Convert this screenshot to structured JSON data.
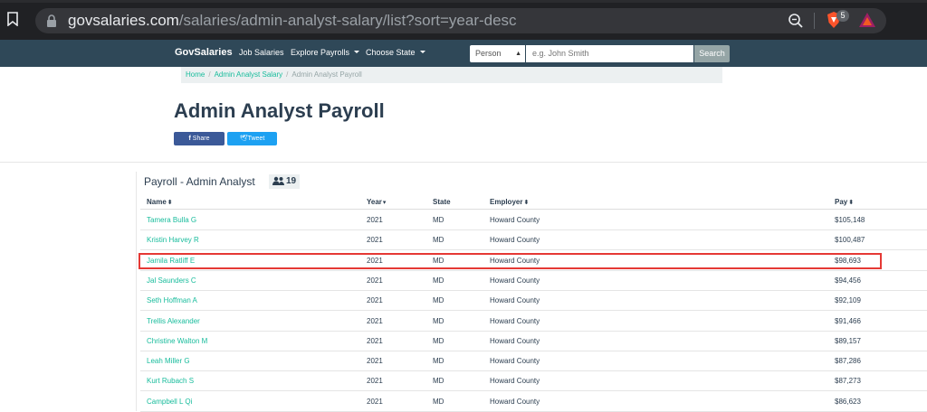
{
  "browser": {
    "url_host": "govsalaries.com",
    "url_path": "/salaries/admin-analyst-salary/list?sort=year-desc",
    "shields_count": "5"
  },
  "navbar": {
    "brand": "GovSalaries",
    "links": [
      "Job Salaries",
      "Explore Payrolls",
      "Choose State"
    ],
    "search_type": "Person",
    "search_placeholder": "e.g. John Smith",
    "search_button": "Search"
  },
  "breadcrumb": [
    "Home",
    "Admin Analyst Salary",
    "Admin Analyst Payroll"
  ],
  "page": {
    "title": "Admin Analyst Payroll",
    "share_label": "Share",
    "tweet_label": "Tweet"
  },
  "payroll": {
    "title": "Payroll - Admin Analyst",
    "count": "19",
    "columns": [
      "Name",
      "Year",
      "State",
      "Employer",
      "Pay"
    ],
    "rows": [
      {
        "name": "Tamera Bulla G",
        "year": "2021",
        "state": "MD",
        "employer": "Howard County",
        "pay": "$105,148"
      },
      {
        "name": "Kristin Harvey R",
        "year": "2021",
        "state": "MD",
        "employer": "Howard County",
        "pay": "$100,487"
      },
      {
        "name": "Jamila Ratliff E",
        "year": "2021",
        "state": "MD",
        "employer": "Howard County",
        "pay": "$98,693"
      },
      {
        "name": "Jal Saunders C",
        "year": "2021",
        "state": "MD",
        "employer": "Howard County",
        "pay": "$94,456"
      },
      {
        "name": "Seth Hoffman A",
        "year": "2021",
        "state": "MD",
        "employer": "Howard County",
        "pay": "$92,109"
      },
      {
        "name": "Trellis Alexander",
        "year": "2021",
        "state": "MD",
        "employer": "Howard County",
        "pay": "$91,466"
      },
      {
        "name": "Christine Walton M",
        "year": "2021",
        "state": "MD",
        "employer": "Howard County",
        "pay": "$89,157"
      },
      {
        "name": "Leah Miller G",
        "year": "2021",
        "state": "MD",
        "employer": "Howard County",
        "pay": "$87,286"
      },
      {
        "name": "Kurt Rubach S",
        "year": "2021",
        "state": "MD",
        "employer": "Howard County",
        "pay": "$87,273"
      },
      {
        "name": "Campbell L Qi",
        "year": "2021",
        "state": "MD",
        "employer": "Howard County",
        "pay": "$86,623"
      }
    ]
  },
  "colors": {
    "navbar": "#2f4858",
    "link": "#18bc9c",
    "highlight": "#e53935",
    "facebook": "#3b5998",
    "twitter": "#1da1f2"
  }
}
